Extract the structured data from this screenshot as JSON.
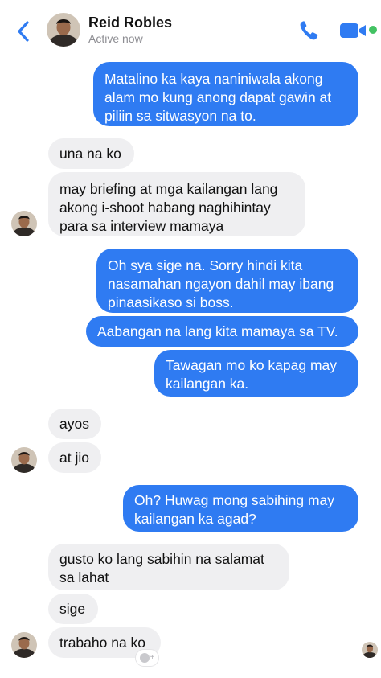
{
  "header": {
    "contact_name": "Reid Robles",
    "status": "Active now",
    "accent": "#2f7bf2",
    "online_color": "#43c263",
    "icons": [
      "chevron-left-icon",
      "phone-icon",
      "video-camera-icon"
    ]
  },
  "messages": [
    {
      "side": "out",
      "text": "Matalino ka kaya naniniwala akong alam mo kung anong dapat gawin at piliin sa sitwasyon na to."
    },
    {
      "side": "in",
      "text": "una na ko"
    },
    {
      "side": "in",
      "text": "may briefing at mga kailangan lang akong i-shoot habang naghihintay para sa interview mamaya"
    },
    {
      "side": "out",
      "text": "Oh sya sige na. Sorry hindi kita nasamahan ngayon dahil may ibang pinaasikaso si boss."
    },
    {
      "side": "out",
      "text": "Aabangan na lang kita mamaya sa TV."
    },
    {
      "side": "out",
      "text": "Tawagan mo ko kapag may kailangan ka."
    },
    {
      "side": "in",
      "text": "ayos"
    },
    {
      "side": "in",
      "text": "at jio"
    },
    {
      "side": "out",
      "text": "Oh? Huwag mong sabihing may kailangan ka agad?"
    },
    {
      "side": "in",
      "text": "gusto ko lang sabihin na salamat sa lahat"
    },
    {
      "side": "in",
      "text": "sige"
    },
    {
      "side": "in",
      "text": "trabaho na ko"
    }
  ],
  "colors": {
    "outgoing_bubble": "#2f7bf2",
    "incoming_bubble": "#efeff1"
  }
}
